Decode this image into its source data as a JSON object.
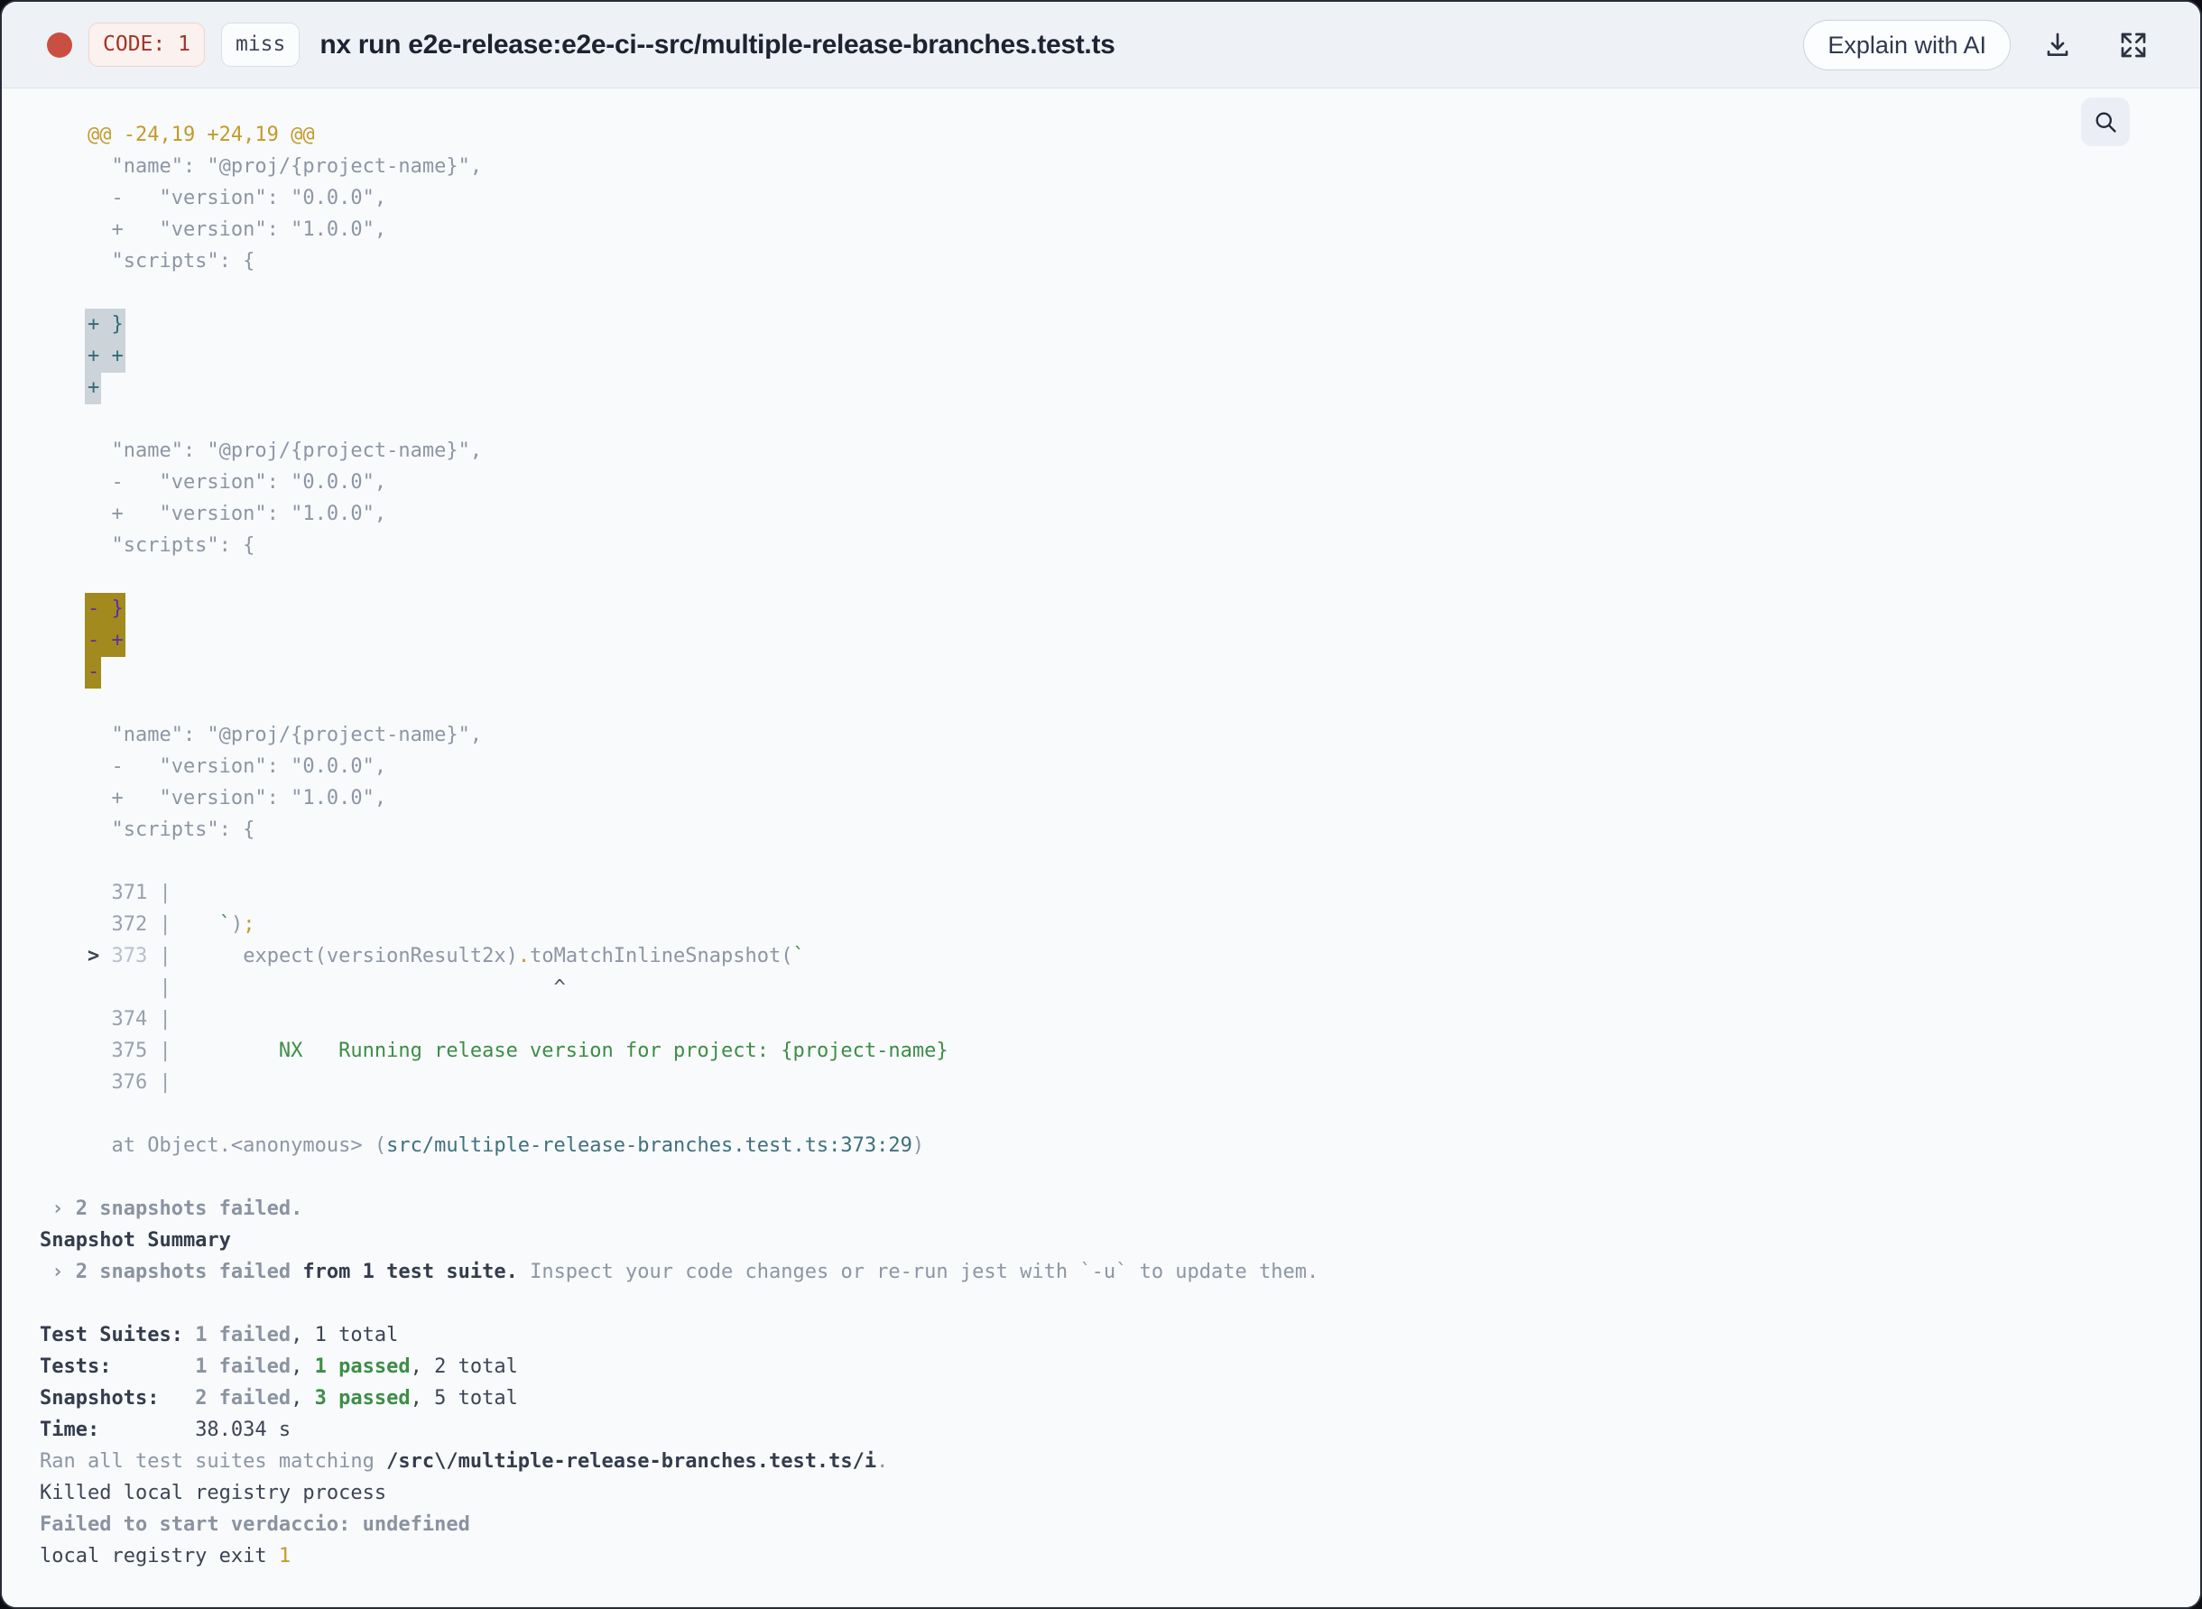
{
  "header": {
    "status_dot_color": "#c94f43",
    "code_badge": "CODE: 1",
    "cache_badge": "miss",
    "title": "nx run e2e-release:e2e-ci--src/multiple-release-branches.test.ts",
    "explain_button_label": "Explain with AI",
    "icons": [
      "download-icon",
      "expand-icon"
    ]
  },
  "search": {
    "icon": "search-icon"
  },
  "colors": {
    "header_bg": "#eef1f6",
    "content_bg": "#f8fafc",
    "diff_gold": "#c39a2a",
    "code_gray": "#8d96a4",
    "green": "#3d8d46",
    "teal_path": "#40707c",
    "highlight_add_bg": "#ccd3d9",
    "highlight_add_text": "#2f6b7a",
    "highlight_removed_bg": "#a28a1e",
    "highlight_removed_text": "#5a2fa8",
    "error_red": "#c94f43"
  },
  "terminal": {
    "lines": [
      [
        [
          "gold",
          "    @@ -24,19 +24,19 @@"
        ]
      ],
      [
        [
          "gray",
          "      \"name\": \"@proj/{project-name}\","
        ]
      ],
      [
        [
          "gray",
          "      -   \"version\": \"0.0.0\","
        ]
      ],
      [
        [
          "gray",
          "      +   \"version\": \"1.0.0\","
        ]
      ],
      [
        [
          "gray",
          "      \"scripts\": {"
        ]
      ],
      [],
      [
        [
          "plain",
          "    "
        ],
        [
          "hl-add",
          "+ }"
        ]
      ],
      [
        [
          "plain",
          "    "
        ],
        [
          "hl-add",
          "+ +"
        ]
      ],
      [
        [
          "plain",
          "    "
        ],
        [
          "hl-add",
          "+"
        ]
      ],
      [],
      [
        [
          "gray",
          "      \"name\": \"@proj/{project-name}\","
        ]
      ],
      [
        [
          "gray",
          "      -   \"version\": \"0.0.0\","
        ]
      ],
      [
        [
          "gray",
          "      +   \"version\": \"1.0.0\","
        ]
      ],
      [
        [
          "gray",
          "      \"scripts\": {"
        ]
      ],
      [],
      [
        [
          "plain",
          "    "
        ],
        [
          "hl-rem",
          "- }"
        ]
      ],
      [
        [
          "plain",
          "    "
        ],
        [
          "hl-rem",
          "- +"
        ]
      ],
      [
        [
          "plain",
          "    "
        ],
        [
          "hl-rem",
          "-"
        ]
      ],
      [],
      [
        [
          "gray",
          "      \"name\": \"@proj/{project-name}\","
        ]
      ],
      [
        [
          "gray",
          "      -   \"version\": \"0.0.0\","
        ]
      ],
      [
        [
          "gray",
          "      +   \"version\": \"1.0.0\","
        ]
      ],
      [
        [
          "gray",
          "      \"scripts\": {"
        ]
      ],
      [],
      [
        [
          "linenum",
          "      371 |"
        ]
      ],
      [
        [
          "linenum",
          "      372 |"
        ],
        [
          "gray",
          "    "
        ],
        [
          "green",
          "`"
        ],
        [
          "gray",
          ")"
        ],
        [
          "gold",
          ";"
        ]
      ],
      [
        [
          "arrow",
          "    > "
        ],
        [
          "dim",
          "373"
        ],
        [
          "linenum",
          " |"
        ],
        [
          "gray",
          "      expect(versionResult2x)"
        ],
        [
          "gold",
          "."
        ],
        [
          "gray",
          "toMatchInlineSnapshot("
        ],
        [
          "green",
          "`"
        ]
      ],
      [
        [
          "linenum",
          "          |"
        ],
        [
          "caret",
          "                                ^"
        ]
      ],
      [
        [
          "linenum",
          "      374 |"
        ]
      ],
      [
        [
          "linenum",
          "      375 |"
        ],
        [
          "green",
          "         NX   Running release version for project: {project-name}"
        ]
      ],
      [
        [
          "linenum",
          "      376 |"
        ]
      ],
      [],
      [
        [
          "gray",
          "      at Object.<anonymous> ("
        ],
        [
          "teal",
          "src/multiple-release-branches.test.ts:373:29"
        ],
        [
          "gray",
          ")"
        ]
      ],
      [],
      [
        [
          "graybold",
          " › 2 snapshots failed."
        ]
      ],
      [
        [
          "darkbold",
          "Snapshot Summary"
        ]
      ],
      [
        [
          "graybold",
          " › 2 snapshots failed"
        ],
        [
          "darkbold",
          " from 1 test suite."
        ],
        [
          "gray",
          " Inspect your code changes or re-run jest with `-u` to update them."
        ]
      ],
      [],
      [
        [
          "darkbold",
          "Test Suites: "
        ],
        [
          "graybold",
          "1 failed"
        ],
        [
          "dark",
          ", 1 total"
        ]
      ],
      [
        [
          "darkbold",
          "Tests:       "
        ],
        [
          "graybold",
          "1 failed"
        ],
        [
          "dark",
          ", "
        ],
        [
          "greenbold",
          "1 passed"
        ],
        [
          "dark",
          ", 2 total"
        ]
      ],
      [
        [
          "darkbold",
          "Snapshots:   "
        ],
        [
          "graybold",
          "2 failed"
        ],
        [
          "dark",
          ", "
        ],
        [
          "greenbold",
          "3 passed"
        ],
        [
          "dark",
          ", 5 total"
        ]
      ],
      [
        [
          "darkbold",
          "Time:        "
        ],
        [
          "dark",
          "38.034 s"
        ]
      ],
      [
        [
          "gray",
          "Ran all test suites matching "
        ],
        [
          "darkbold",
          "/src\\/multiple-release-branches.test.ts/i"
        ],
        [
          "gray",
          "."
        ]
      ],
      [
        [
          "dark",
          "Killed local registry process"
        ]
      ],
      [
        [
          "graybold",
          "Failed to start verdaccio: undefined"
        ]
      ],
      [
        [
          "dark",
          "local registry exit "
        ],
        [
          "gold",
          "1"
        ]
      ]
    ]
  }
}
